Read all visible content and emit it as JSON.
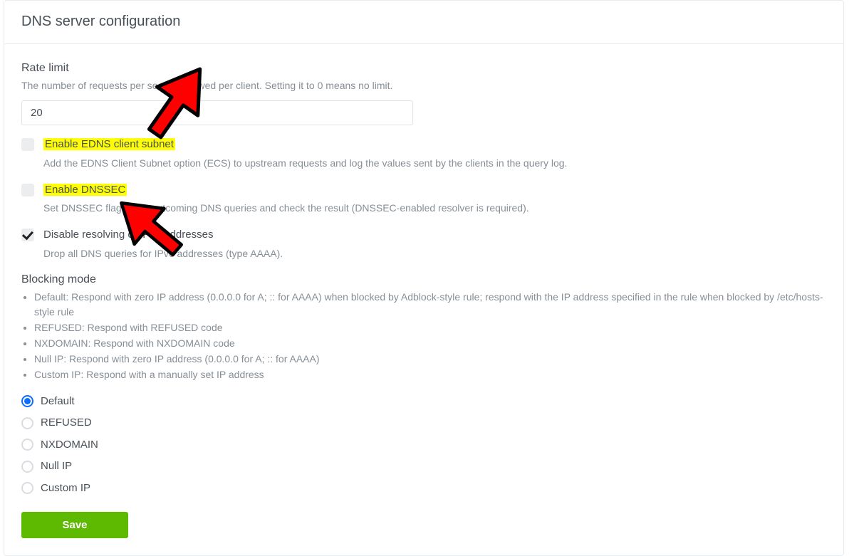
{
  "card": {
    "title": "DNS server configuration"
  },
  "rateLimit": {
    "label": "Rate limit",
    "help": "The number of requests per second allowed per client. Setting it to 0 means no limit.",
    "value": "20"
  },
  "checks": {
    "edns": {
      "label": "Enable EDNS client subnet",
      "desc": "Add the EDNS Client Subnet option (ECS) to upstream requests and log the values sent by the clients in the query log."
    },
    "dnssec": {
      "label": "Enable DNSSEC",
      "desc": "Set DNSSEC flag in the outcoming DNS queries and check the result (DNSSEC-enabled resolver is required)."
    },
    "ipv6": {
      "label": "Disable resolving of IPv6 addresses",
      "desc": "Drop all DNS queries for IPv6 addresses (type AAAA)."
    }
  },
  "blocking": {
    "title": "Blocking mode",
    "bullets": [
      "Default: Respond with zero IP address (0.0.0.0 for A; :: for AAAA) when blocked by Adblock-style rule; respond with the IP address specified in the rule when blocked by /etc/hosts-style rule",
      "REFUSED: Respond with REFUSED code",
      "NXDOMAIN: Respond with NXDOMAIN code",
      "Null IP: Respond with zero IP address (0.0.0.0 for A; :: for AAAA)",
      "Custom IP: Respond with a manually set IP address"
    ],
    "options": {
      "default": "Default",
      "refused": "REFUSED",
      "nxdomain": "NXDOMAIN",
      "nullip": "Null IP",
      "customip": "Custom IP"
    }
  },
  "buttons": {
    "save": "Save"
  }
}
